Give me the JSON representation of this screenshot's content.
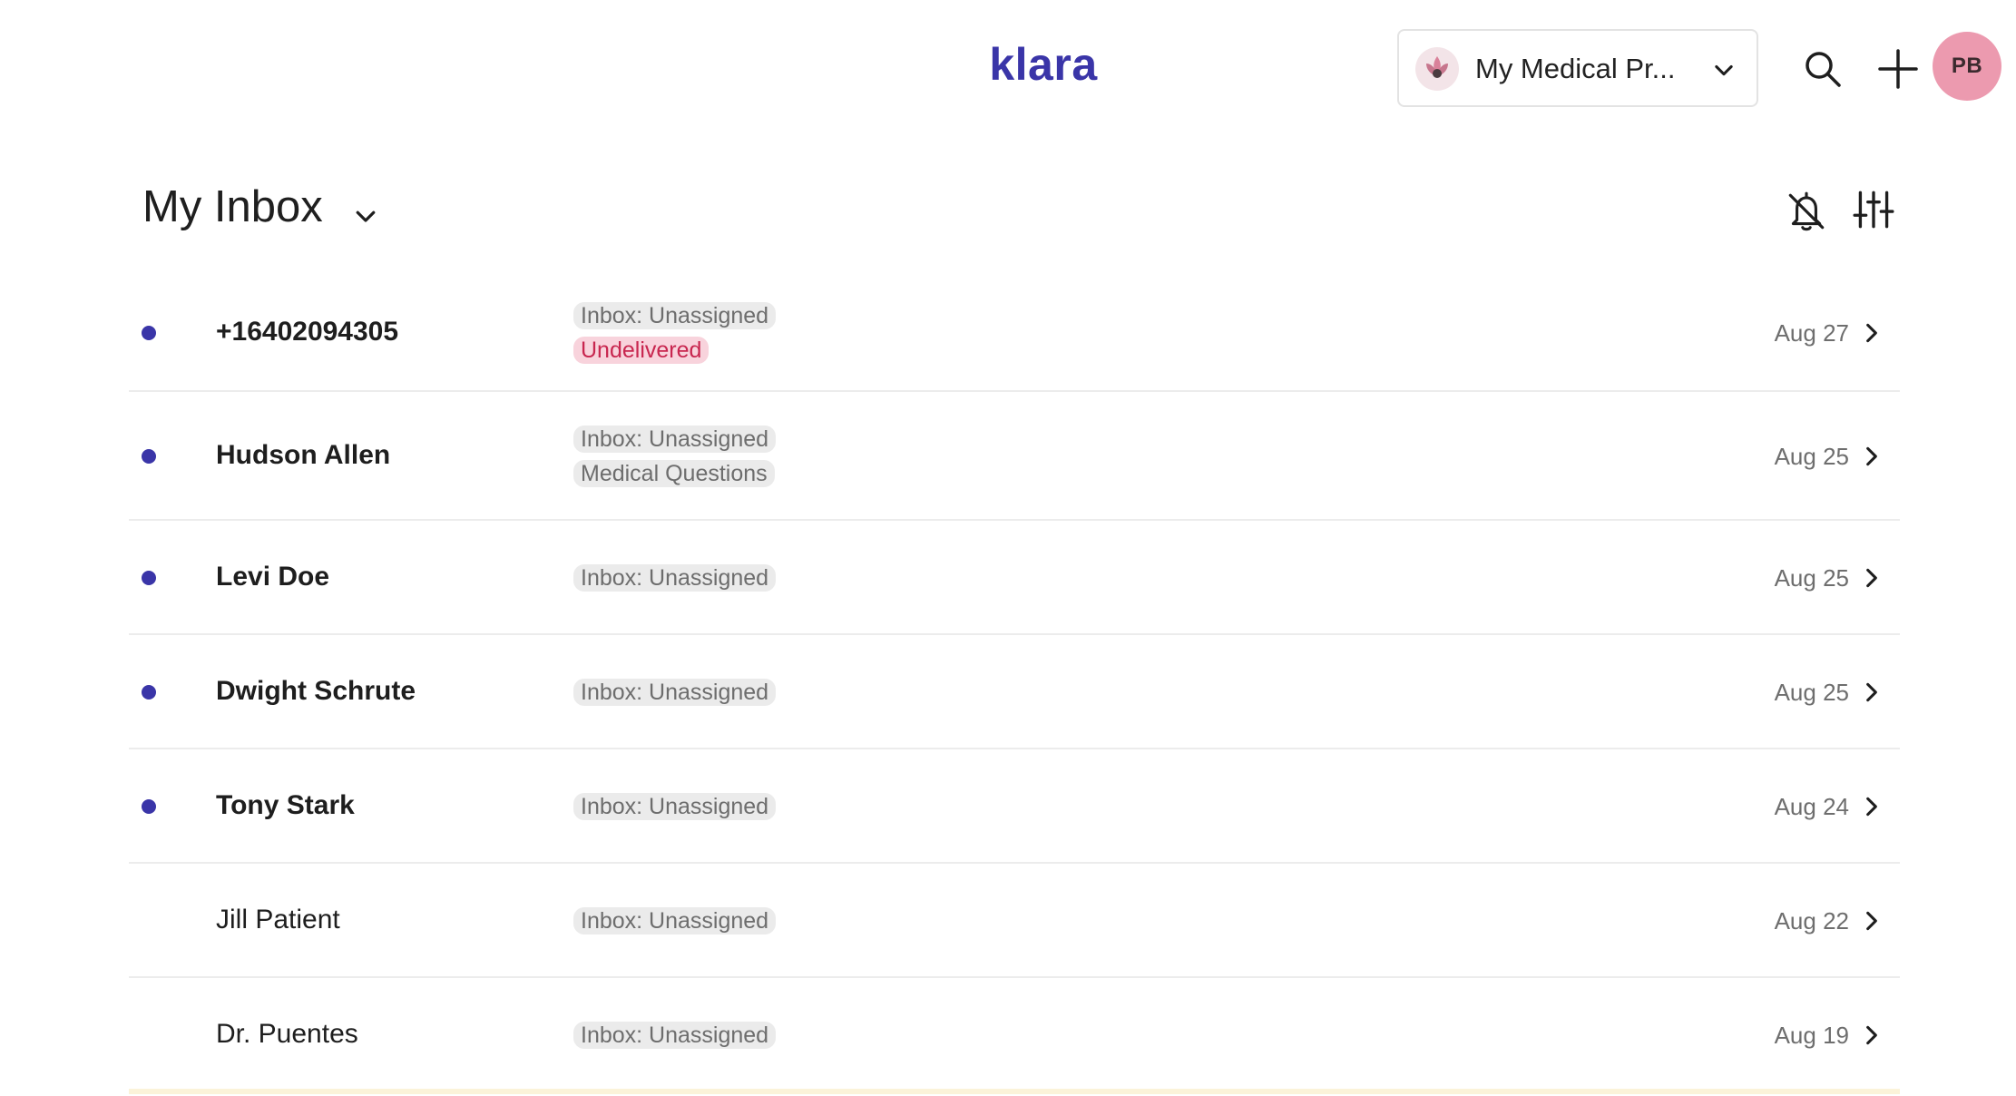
{
  "header": {
    "logo": "klara",
    "practice": {
      "label": "My Medical Pr..."
    },
    "avatar_initials": "PB"
  },
  "inbox": {
    "title": "My Inbox"
  },
  "rows": [
    {
      "name": "+16402094305",
      "unread": true,
      "tags": [
        {
          "label": "Inbox: Unassigned",
          "style": "gray"
        },
        {
          "label": "Undelivered",
          "style": "red"
        }
      ],
      "date": "Aug 27"
    },
    {
      "name": "Hudson Allen",
      "unread": true,
      "tags": [
        {
          "label": "Inbox: Unassigned",
          "style": "gray"
        },
        {
          "label": "Medical Questions",
          "style": "gray"
        }
      ],
      "date": "Aug 25"
    },
    {
      "name": "Levi Doe",
      "unread": true,
      "tags": [
        {
          "label": "Inbox: Unassigned",
          "style": "gray"
        }
      ],
      "date": "Aug 25"
    },
    {
      "name": "Dwight Schrute",
      "unread": true,
      "tags": [
        {
          "label": "Inbox: Unassigned",
          "style": "gray"
        }
      ],
      "date": "Aug 25"
    },
    {
      "name": "Tony Stark",
      "unread": true,
      "tags": [
        {
          "label": "Inbox: Unassigned",
          "style": "gray"
        }
      ],
      "date": "Aug 24"
    },
    {
      "name": "Jill Patient",
      "unread": false,
      "tags": [
        {
          "label": "Inbox: Unassigned",
          "style": "gray"
        }
      ],
      "date": "Aug 22"
    },
    {
      "name": "Dr. Puentes",
      "unread": false,
      "tags": [
        {
          "label": "Inbox: Unassigned",
          "style": "gray"
        }
      ],
      "date": "Aug 19"
    }
  ],
  "colors": {
    "brand": "#3a35a8",
    "avatar_bg": "#ec9aaf",
    "tag_gray_bg": "#ebebeb",
    "tag_red_bg": "#f8d3dc",
    "tag_red_text": "#c8264f"
  },
  "icons": {
    "search": "search-icon",
    "add": "plus-icon",
    "notifications_off": "bell-off-icon",
    "filters": "sliders-icon",
    "dropdown": "chevron-down-icon",
    "open_row": "chevron-right-icon"
  }
}
